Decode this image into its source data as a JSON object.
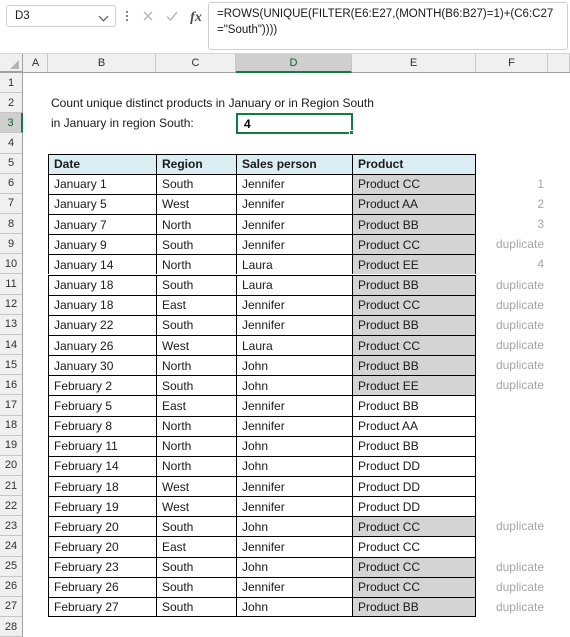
{
  "app": {
    "name_box": {
      "value": "D3",
      "icon": "chevron-down-icon"
    },
    "kebab_icon": "more-options-icon",
    "cancel_icon": "cancel-icon",
    "enter_icon": "enter-checkmark-icon",
    "fx_label": "fx",
    "formula": "=ROWS(UNIQUE(FILTER(E6:E27,(MONTH(B6:B27)=1)+(C6:C27=\"South\"))))",
    "accent_green": "#107c41",
    "header_fill": "#daeef3",
    "shaded_fill": "#d4d4d4",
    "annotation_color": "#a6a6a6"
  },
  "grid": {
    "columns": [
      "A",
      "B",
      "C",
      "D",
      "E",
      "F"
    ],
    "active_column": "D",
    "active_row": 3,
    "rows": [
      1,
      2,
      3,
      4,
      5,
      6,
      7,
      8,
      9,
      10,
      11,
      12,
      13,
      14,
      15,
      16,
      17,
      18,
      19,
      20,
      21,
      22,
      23,
      24,
      25,
      26,
      27,
      28
    ]
  },
  "notes": {
    "line1": "Count unique distinct products in January or in Region South",
    "line2": "in January in region South:"
  },
  "result": {
    "value": "4"
  },
  "table": {
    "headers": [
      "Date",
      "Region",
      "Sales person",
      "Product"
    ],
    "rows": [
      {
        "row": 6,
        "date": "January 1",
        "region": "South",
        "person": "Jennifer",
        "product": "Product CC",
        "shaded": true,
        "note": "1"
      },
      {
        "row": 7,
        "date": "January 5",
        "region": "West",
        "person": "Jennifer",
        "product": "Product AA",
        "shaded": true,
        "note": "2"
      },
      {
        "row": 8,
        "date": "January 7",
        "region": "North",
        "person": "Jennifer",
        "product": "Product BB",
        "shaded": true,
        "note": "3"
      },
      {
        "row": 9,
        "date": "January 9",
        "region": "South",
        "person": "Jennifer",
        "product": "Product CC",
        "shaded": true,
        "note": "duplicate"
      },
      {
        "row": 10,
        "date": "January 14",
        "region": "North",
        "person": "Laura",
        "product": "Product EE",
        "shaded": true,
        "note": "4"
      },
      {
        "row": 11,
        "date": "January 18",
        "region": "South",
        "person": "Laura",
        "product": "Product BB",
        "shaded": true,
        "note": "duplicate"
      },
      {
        "row": 12,
        "date": "January 18",
        "region": "East",
        "person": "Jennifer",
        "product": "Product CC",
        "shaded": true,
        "note": "duplicate"
      },
      {
        "row": 13,
        "date": "January 22",
        "region": "South",
        "person": "Jennifer",
        "product": "Product BB",
        "shaded": true,
        "note": "duplicate"
      },
      {
        "row": 14,
        "date": "January 26",
        "region": "West",
        "person": "Laura",
        "product": "Product CC",
        "shaded": true,
        "note": "duplicate"
      },
      {
        "row": 15,
        "date": "January 30",
        "region": "North",
        "person": "John",
        "product": "Product BB",
        "shaded": true,
        "note": "duplicate"
      },
      {
        "row": 16,
        "date": "February 2",
        "region": "South",
        "person": "John",
        "product": "Product EE",
        "shaded": true,
        "note": "duplicate"
      },
      {
        "row": 17,
        "date": "February 5",
        "region": "East",
        "person": "Jennifer",
        "product": "Product BB",
        "shaded": false,
        "note": ""
      },
      {
        "row": 18,
        "date": "February 8",
        "region": "North",
        "person": "Jennifer",
        "product": "Product AA",
        "shaded": false,
        "note": ""
      },
      {
        "row": 19,
        "date": "February 11",
        "region": "North",
        "person": "John",
        "product": "Product BB",
        "shaded": false,
        "note": ""
      },
      {
        "row": 20,
        "date": "February 14",
        "region": "North",
        "person": "John",
        "product": "Product DD",
        "shaded": false,
        "note": ""
      },
      {
        "row": 21,
        "date": "February 18",
        "region": "West",
        "person": "Jennifer",
        "product": "Product DD",
        "shaded": false,
        "note": ""
      },
      {
        "row": 22,
        "date": "February 19",
        "region": "West",
        "person": "Jennifer",
        "product": "Product DD",
        "shaded": false,
        "note": ""
      },
      {
        "row": 23,
        "date": "February 20",
        "region": "South",
        "person": "John",
        "product": "Product CC",
        "shaded": true,
        "note": "duplicate"
      },
      {
        "row": 24,
        "date": "February 20",
        "region": "East",
        "person": "Jennifer",
        "product": "Product CC",
        "shaded": false,
        "note": ""
      },
      {
        "row": 25,
        "date": "February 23",
        "region": "South",
        "person": "John",
        "product": "Product CC",
        "shaded": true,
        "note": "duplicate"
      },
      {
        "row": 26,
        "date": "February 26",
        "region": "South",
        "person": "Jennifer",
        "product": "Product CC",
        "shaded": true,
        "note": "duplicate"
      },
      {
        "row": 27,
        "date": "February 27",
        "region": "South",
        "person": "John",
        "product": "Product BB",
        "shaded": true,
        "note": "duplicate"
      }
    ]
  }
}
